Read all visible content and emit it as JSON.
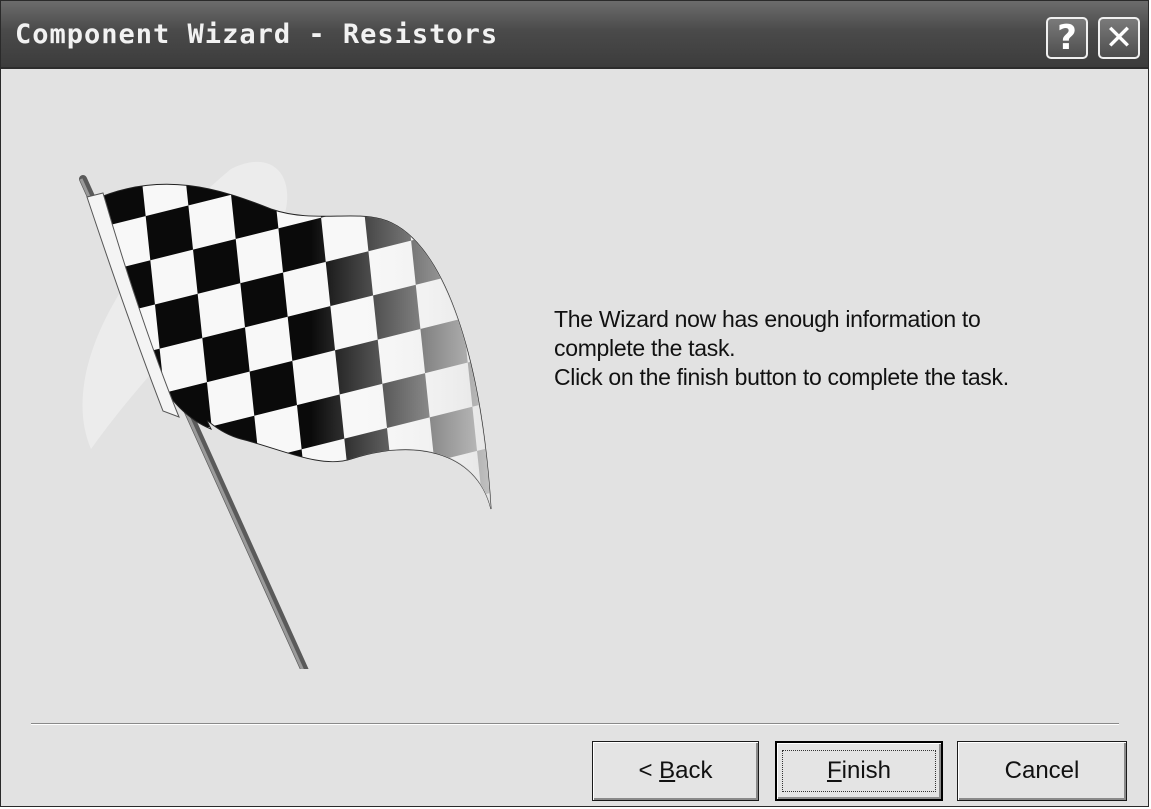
{
  "window": {
    "title": "Component Wizard - Resistors"
  },
  "titlebar_buttons": {
    "help_label": "?",
    "close_label": "✕"
  },
  "message": {
    "line1": "The Wizard now has enough information to",
    "line2": "complete the task.",
    "line3": "Click on the finish button to complete the task."
  },
  "buttons": {
    "back_prefix": "< ",
    "back_mnemonic": "B",
    "back_rest": "ack",
    "finish_mnemonic": "F",
    "finish_rest": "inish",
    "cancel_label": "Cancel"
  },
  "illustration": {
    "icon": "checkered-flag-icon"
  }
}
